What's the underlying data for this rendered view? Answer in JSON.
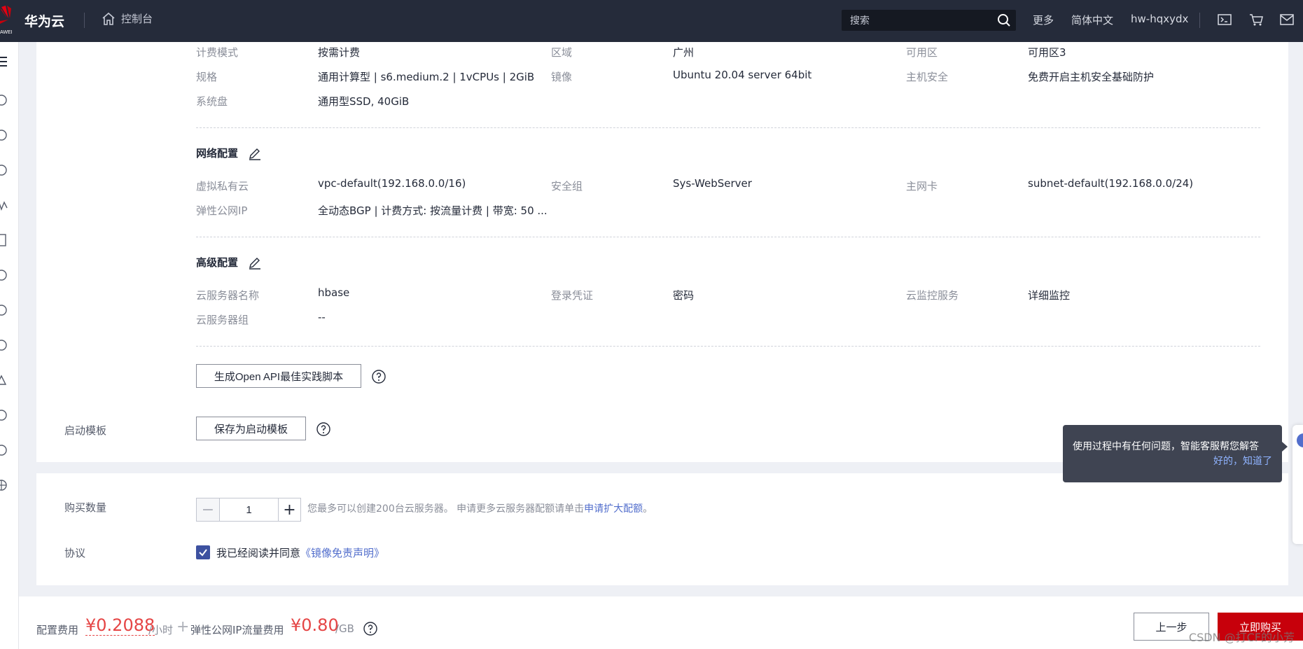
{
  "topbar": {
    "brand": "华为云",
    "logo_sub": "AWEI",
    "console": "控制台",
    "search_placeholder": "搜索",
    "more": "更多",
    "language": "简体中文",
    "user": "hw-hqxydx",
    "icons": [
      "terminal-icon",
      "cart-icon",
      "mail-icon"
    ]
  },
  "basic": {
    "billing_mode_label": "计费模式",
    "billing_mode": "按需计费",
    "region_label": "区域",
    "region": "广州",
    "az_label": "可用区",
    "az": "可用区3",
    "flavor_label": "规格",
    "flavor": "通用计算型 | s6.medium.2 | 1vCPUs | 2GiB",
    "image_label": "镜像",
    "image": "Ubuntu 20.04 server 64bit",
    "host_security_label": "主机安全",
    "host_security": "免费开启主机安全基础防护",
    "system_disk_label": "系统盘",
    "system_disk": "通用型SSD, 40GiB"
  },
  "network": {
    "title": "网络配置",
    "vpc_label": "虚拟私有云",
    "vpc": "vpc-default(192.168.0.0/16)",
    "sg_label": "安全组",
    "sg": "Sys-WebServer",
    "nic_label": "主网卡",
    "nic": "subnet-default(192.168.0.0/24)",
    "eip_label": "弹性公网IP",
    "eip": "全动态BGP | 计费方式: 按流量计费 | 带宽: 50 ..."
  },
  "advanced": {
    "title": "高级配置",
    "name_label": "云服务器名称",
    "name": "hbase",
    "credential_label": "登录凭证",
    "credential": "密码",
    "monitor_label": "云监控服务",
    "monitor": "详细监控",
    "group_label": "云服务器组",
    "group": "--"
  },
  "openapi_button": "生成Open API最佳实践脚本",
  "template": {
    "label": "启动模板",
    "button": "保存为启动模板"
  },
  "purchase": {
    "quantity_label": "购买数量",
    "quantity": "1",
    "quota_text": "您最多可以创建200台云服务器。 申请更多云服务器配额请单击",
    "quota_link": "申请扩大配额",
    "quota_end": "。",
    "agreement_label": "协议",
    "agree_text": "我已经阅读并同意",
    "agree_link": "《镜像免责声明》",
    "agreed": true
  },
  "tooltip": {
    "text": "使用过程中有任何问题，智能客服帮您解答",
    "ok": "好的，知道了"
  },
  "footer": {
    "config_fee_label": "配置费用",
    "config_fee": "¥0.2088",
    "config_fee_unit": "/小时",
    "plus": "+",
    "eip_fee_label": "弹性公网IP流量费用",
    "eip_fee": "¥0.80",
    "eip_fee_unit": "/GB",
    "prev": "上一步",
    "buy": "立即购买",
    "watermark": "CSDN @打CF的小芳"
  },
  "colors": {
    "accent": "#526ecc",
    "price": "#e54545",
    "buy": "#c7000b",
    "topbar": "#252b3a"
  }
}
